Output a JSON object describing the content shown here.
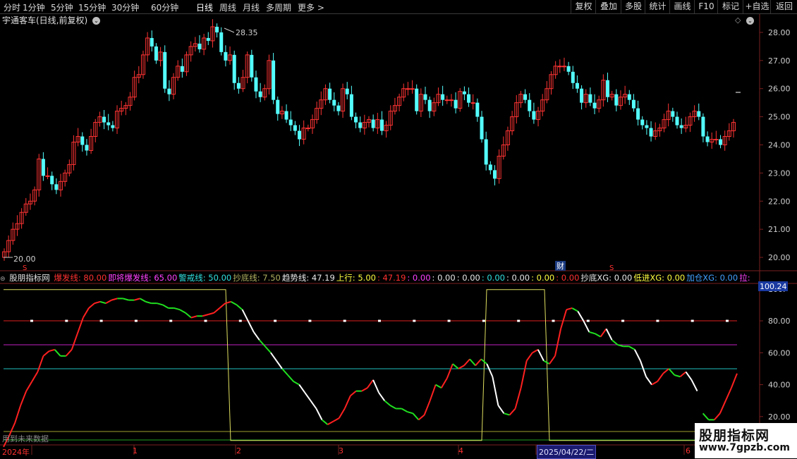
{
  "toolbar": {
    "periods": [
      "分时",
      "1分钟",
      "5分钟",
      "15分钟",
      "30分钟",
      "60分钟",
      "日线",
      "周线",
      "月线",
      "多周期",
      "更多 >"
    ],
    "active_period": "日线",
    "right_buttons": [
      "复权",
      "叠加",
      "多股",
      "统计",
      "画线",
      "F10",
      "标记",
      "+自选",
      "返回"
    ]
  },
  "stock": {
    "title": "宇通客车(日线,前复权)",
    "high_marker": "28.35",
    "low_marker": "20.00"
  },
  "price_axis": {
    "labels": [
      "28.00",
      "27.00",
      "26.00",
      "25.00",
      "24.00",
      "23.00",
      "22.00",
      "21.00",
      "20.00"
    ],
    "values": [
      28,
      27,
      26,
      25,
      24,
      23,
      22,
      21,
      20
    ]
  },
  "markers": {
    "finance": "财",
    "s_marks": [
      "S",
      "S"
    ]
  },
  "indicator": {
    "name": "股朋指标网",
    "items": [
      {
        "label": "爆发线: 80.00",
        "color": "#ff3030"
      },
      {
        "label": "即将爆发线: 65.00",
        "color": "#ff40ff"
      },
      {
        "label": "警戒线: 50.00",
        "color": "#30e0e0"
      },
      {
        "label": "抄底线: 7.50",
        "color": "#b0b060"
      },
      {
        "label": "趋势线: 47.19",
        "color": "#e8e8e8"
      },
      {
        "label": "上行: 5.00",
        "color": "#ffff40"
      },
      {
        "label": ": 47.19",
        "color": "#ff3030"
      },
      {
        "label": ": 0.00",
        "color": "#ff40ff"
      },
      {
        "label": ": 0.00",
        "color": "#e8e8e8"
      },
      {
        "label": ": 0.00",
        "color": "#e8e8e8"
      },
      {
        "label": ": 0.00",
        "color": "#30e0e0"
      },
      {
        "label": ": 0.00",
        "color": "#e8e8e8"
      },
      {
        "label": ": 0.00",
        "color": "#ffff40"
      },
      {
        "label": ": 0.00",
        "color": "#ff3030"
      },
      {
        "label": "抄底XG: 0.00",
        "color": "#e8e8e8"
      },
      {
        "label": "低进XG: 0.00",
        "color": "#ffff40"
      },
      {
        "label": "加仓XG: 0.00",
        "color": "#40a0ff"
      },
      {
        "label": "拉:",
        "color": "#ff40ff"
      }
    ],
    "current_value": "100.24",
    "axis_labels": [
      "100.",
      "80.00",
      "60.00",
      "40.00",
      "20.00"
    ],
    "axis_values": [
      100,
      80,
      60,
      40,
      20
    ],
    "future_note": "用到未来数据"
  },
  "timeline": {
    "labels": [
      "2024年",
      "1",
      "2",
      "3",
      "4",
      "5",
      "6"
    ],
    "highlight_date": "2025/04/22/二"
  },
  "watermark": {
    "line1": "股朋指标网",
    "line2": "www.7gpzb.com"
  },
  "colors": {
    "up": "#ff3333",
    "down": "#54ffff",
    "trend_up": "#ff2020",
    "trend_down": "#20e020",
    "trend_flat": "#ffffff"
  },
  "chart_data": {
    "type": "candlestick",
    "series": [
      {
        "name": "price_close",
        "values": [
          20.2,
          20.6,
          21.0,
          21.2,
          21.6,
          21.9,
          22.0,
          22.4,
          23.5,
          22.9,
          22.9,
          22.6,
          22.4,
          22.7,
          23.0,
          23.3,
          24.1,
          24.3,
          24.0,
          23.8,
          24.3,
          24.8,
          25.0,
          24.8,
          24.7,
          24.6,
          25.2,
          25.3,
          25.4,
          25.7,
          26.4,
          26.5,
          27.2,
          27.8,
          27.5,
          27.0,
          27.3,
          26.0,
          25.8,
          26.4,
          26.8,
          26.6,
          27.2,
          27.5,
          27.6,
          27.4,
          27.8,
          27.7,
          28.2,
          28.0,
          27.3,
          27.0,
          27.2,
          26.2,
          26.0,
          26.4,
          27.2,
          26.4,
          25.9,
          25.7,
          26.0,
          27.0,
          25.6,
          25.1,
          25.2,
          24.9,
          24.7,
          24.5,
          24.2,
          24.6,
          24.6,
          24.9,
          25.3,
          25.6,
          26.0,
          25.6,
          25.4,
          25.2,
          26.0,
          25.8,
          25.0,
          24.8,
          24.6,
          24.8,
          24.9,
          24.6,
          24.9,
          24.5,
          24.7,
          25.2,
          25.4,
          25.7,
          26.0,
          26.0,
          26.0,
          25.2,
          25.8,
          25.6,
          25.2,
          25.5,
          25.8,
          25.6,
          25.6,
          25.6,
          25.3,
          25.9,
          25.8,
          25.5,
          25.5,
          25.0,
          24.2,
          23.3,
          23.1,
          22.8,
          23.6,
          24.0,
          24.5,
          25.0,
          25.5,
          25.8,
          25.6,
          25.2,
          24.9,
          25.2,
          25.6,
          26.0,
          26.5,
          26.8,
          26.8,
          26.8,
          26.6,
          26.2,
          26.0,
          25.5,
          25.8,
          25.5,
          25.3,
          25.6,
          26.3,
          25.7,
          25.8,
          25.4,
          25.7,
          25.8,
          25.6,
          25.3,
          24.9,
          24.7,
          24.6,
          24.3,
          24.5,
          24.6,
          24.9,
          25.2,
          25.0,
          24.7,
          24.6,
          24.7,
          25.0,
          25.2,
          25.0,
          24.3,
          24.1,
          24.2,
          24.2,
          24.0,
          24.3,
          24.5,
          24.8
        ]
      },
      {
        "name": "trend_line",
        "values": [
          1,
          8,
          16,
          27,
          36,
          42,
          48,
          58,
          61,
          62,
          58,
          58,
          62,
          72,
          82,
          88,
          91,
          92,
          91,
          93,
          94,
          94,
          93,
          93,
          94,
          92,
          91,
          91,
          90,
          88,
          88,
          87,
          85,
          82,
          83,
          83,
          84,
          85,
          88,
          91,
          92,
          90,
          87,
          80,
          73,
          68,
          64,
          60,
          55,
          50,
          46,
          42,
          40,
          35,
          30,
          25,
          18,
          15,
          17,
          19,
          25,
          33,
          36,
          36,
          38,
          43,
          35,
          30,
          27,
          25,
          25,
          23,
          22,
          18,
          21,
          30,
          40,
          38,
          44,
          53,
          50,
          52,
          56,
          52,
          56,
          53,
          45,
          27,
          22,
          21,
          25,
          38,
          55,
          60,
          62,
          55,
          53,
          58,
          75,
          87,
          88,
          86,
          80,
          73,
          72,
          70,
          75,
          68,
          65,
          64,
          64,
          62,
          55,
          45,
          40,
          42,
          47,
          50,
          46,
          45,
          48,
          43,
          36,
          22,
          18,
          18,
          22,
          30,
          38,
          47
        ]
      }
    ],
    "ylim_price": [
      19.6,
      28.6
    ],
    "ylim_indicator": [
      8,
      103
    ],
    "reference_lines": [
      80,
      65,
      50
    ],
    "step_line": {
      "name": "上行",
      "high_value": 100,
      "low_value": 5
    }
  }
}
